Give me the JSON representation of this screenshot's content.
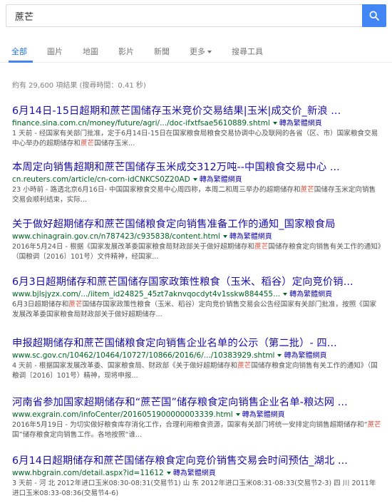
{
  "search": {
    "query": "蔗芒"
  },
  "tabs": [
    {
      "label": "全部"
    },
    {
      "label": "圖片"
    },
    {
      "label": "地圖"
    },
    {
      "label": "影片"
    },
    {
      "label": "新聞"
    },
    {
      "label": "更多"
    },
    {
      "label": "搜尋工具"
    }
  ],
  "stats": "約有 29,600 項結果 (搜尋時間：0.41 秒)",
  "translate_label": "轉為繁體網頁",
  "results": [
    {
      "title": "6月14日-15日超期和蔗芒国储存玉米竞价交易结果|玉米|成交价_新浪 ...",
      "url": "finance.sina.com.cn/money/future/agri/.../doc-ifxtfsae5610889.shtml",
      "snippet_pre": "1 天前 - 经国家有关部门批准，定于6月14日-15日在国家粮食局粮食交易协调中心及联网的各省（区、市）国家粮食交易中心举办的超期储存和",
      "snippet_hl": "蔗芒",
      "snippet_post": "国储存玉米..."
    },
    {
      "title": "本周定向销售超期和蔗芒国储存玉米成交312万吨--中国粮食交易中心 ...",
      "url": "cn.reuters.com/article/cn-corn-idCNKCS0Z20AD",
      "snippet_pre": "23 小時前 - 路透北京6月16日- 中国国家粮食交易中心周四称，本周二和周三举办的超期储存和",
      "snippet_hl": "蔗芒",
      "snippet_post": "国储存玉米定向销售交易会顺利结束，实际..."
    },
    {
      "title": "关于做好超期储存和蔗芒国储粮食定向销售准备工作的通知_国家粮食局",
      "url": "www.chinagrain.gov.cn/n787423/c935838/content.html",
      "snippet_pre": "2016年5月24日 - 根据《国家发展改革委国家粮食局财政部关于做好超期储存和",
      "snippet_hl": "蔗芒",
      "snippet_post": "国储存粮食定向销售有关工作的通知》（国粮调〔2016〕101号）文件精神，经国家..."
    },
    {
      "title": "6月3日超期储存和蔗芒国储存国家政策性粮食（玉米、稻谷）定向竞价销...",
      "url": "www.bjlsjyzx.com/.../iitem_id24825_45zt7aknvqocdyt4v1sskw884455...",
      "snippet_pre": "6月3日超期储存和",
      "snippet_hl": "蔗芒",
      "snippet_post": "国储存国家政策性粮食（玉米、稻谷）定向竞价销售交易会公告经国家有关部门批准，按照《国家发展改革委国家粮食局财政部关于做好超期储存..."
    },
    {
      "title": "申报超期储存和蔗芒国储粮食定向销售企业名单的公示（第二批）- 四...",
      "url": "www.sc.gov.cn/10462/10464/10727/10866/2016/6/.../10383929.shtml",
      "snippet_pre": "4 天前 - 根据国家发展改革委、国家粮食局、财政部《关于做好超期储存和",
      "snippet_hl": "蔗芒",
      "snippet_post": "国储存粮食定向销售有关工作的通知》（国粮调〔2016〕101号）精神，现将申报..."
    },
    {
      "title": "河南省参加国家超期储存和“蔗芒国”储存粮食定向销售企业名单-粮达网 ...",
      "url": "www.exgrain.com/infoCenter/2016051900000003339.html",
      "snippet_pre": "2016年5月19日 - 为切实做好粮食库存消化工作，合理利用粮食资源，国家有关部门将统一安排定向销售超期储存和“",
      "snippet_hl": "蔗芒",
      "snippet_post": "国”储存粮食定向销售工作。各地按照“谁..."
    },
    {
      "title": "6月14日超期储存和蔗芒国储存粮食定向竞价销售交易会时间预估_湖北 ...",
      "url": "www.hbgrain.com/detail.aspx?id=11612",
      "snippet_pre": "3 天前 - 河 北 2012年进口玉米08:30-08:31(交易节1) 山 东 2012年进口玉米08:31-08:33(交易节2-3) 四 川 2011年进口玉米08:33-08:36(交易节4-6)",
      "snippet_hl": "",
      "snippet_post": ""
    }
  ],
  "colors": {
    "accent": "#4285f4",
    "link": "#1a0dab",
    "url": "#006621",
    "highlight": "#dd4b39"
  },
  "icons": {
    "search_button": "search-icon"
  }
}
